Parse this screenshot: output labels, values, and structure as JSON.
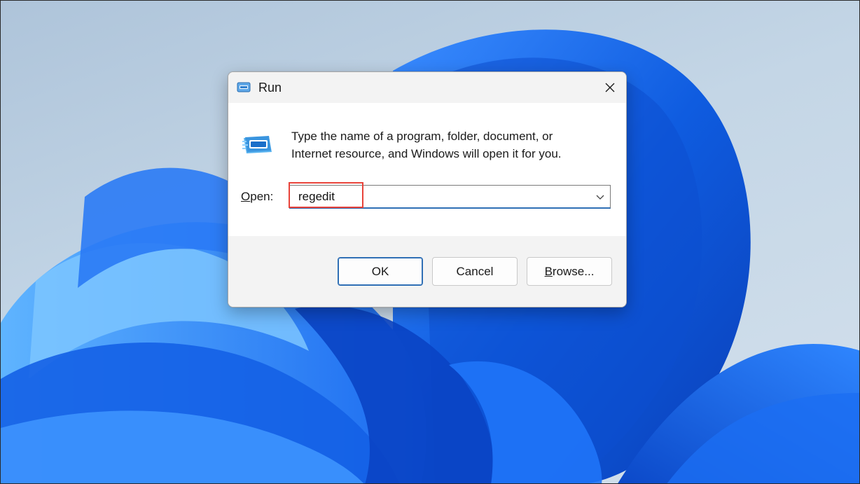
{
  "dialog": {
    "title": "Run",
    "description_line1": "Type the name of a program, folder, document, or",
    "description_line2": "Internet resource, and Windows will open it for you.",
    "open_label_accel": "O",
    "open_label_rest": "pen:",
    "open_value": "regedit"
  },
  "buttons": {
    "ok_label": "OK",
    "cancel_label": "Cancel",
    "browse_accel": "B",
    "browse_rest": "rowse..."
  },
  "icons": {
    "title_icon": "run-icon",
    "big_icon": "run-icon",
    "close": "close-icon",
    "dropdown": "chevron-down-icon"
  },
  "colors": {
    "accent": "#2f6fb5",
    "highlight": "#e8433a",
    "wallpaper_blue": "#1565e8"
  }
}
